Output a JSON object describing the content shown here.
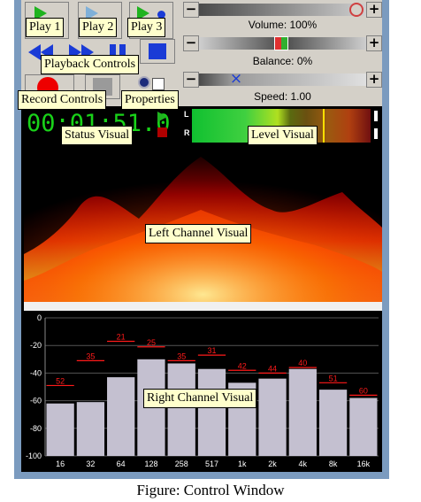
{
  "controls": {
    "volume_caption": "Volume: 100%",
    "balance_caption": "Balance: 0%",
    "speed_caption": "Speed: 1.00",
    "minus": "−",
    "plus": "+",
    "speed_reset_glyph": "×"
  },
  "status": {
    "time": "00:01:51.0",
    "channel_left": "L",
    "channel_right": "R"
  },
  "labels": {
    "play1": "Play 1",
    "play2": "Play 2",
    "play3": "Play 3",
    "playback_controls": "Playback Controls",
    "record_controls": "Record Controls",
    "properties": "Properties",
    "status_visual": "Status Visual",
    "level_visual": "Level Visual",
    "left_channel_visual": "Left Channel Visual",
    "right_channel_visual": "Right Channel Visual"
  },
  "settings": {
    "volume_percent": 100,
    "balance_percent": 0,
    "speed": 1.0
  },
  "chart_data": {
    "type": "bar",
    "categories": [
      "16",
      "32",
      "64",
      "128",
      "258",
      "517",
      "1k",
      "2k",
      "4k",
      "8k",
      "16k"
    ],
    "values": [
      -62,
      -61,
      -43,
      -30,
      -33,
      -37,
      -47,
      -44,
      -37,
      -52,
      -58
    ],
    "peak_labels": [
      "52",
      "35",
      "21",
      "25",
      "35",
      "31",
      "42",
      "44",
      "40",
      "51",
      "60"
    ],
    "peak_values": [
      -49,
      -31,
      -17,
      -21,
      -31,
      -27,
      -38,
      -40,
      -36,
      -47,
      -56
    ],
    "y_ticks": [
      "0",
      "-20",
      "-40",
      "-60",
      "-80",
      "-100"
    ],
    "ylim": [
      -100,
      0
    ],
    "grid": true,
    "colors": {
      "bar": "#c4c0d0",
      "peak": "#ff1a1a",
      "grid": "#555555"
    }
  },
  "caption": "Figure: Control Window"
}
